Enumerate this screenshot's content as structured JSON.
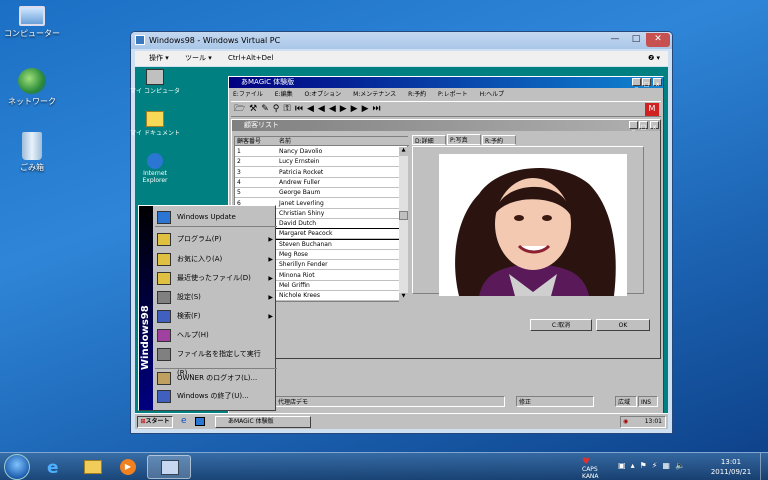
{
  "desktop": {
    "icons": [
      {
        "label": "コンピューター"
      },
      {
        "label": "ネットワーク"
      },
      {
        "label": "ごみ箱"
      }
    ]
  },
  "vpc": {
    "title": "Windows98 - Windows Virtual PC",
    "menu": {
      "ops": "操作 ▾",
      "tools": "ツール ▾",
      "cad": "Ctrl+Alt+Del"
    },
    "help": "❷ ▾"
  },
  "guest": {
    "icons": [
      {
        "label": "マイ コンピュータ"
      },
      {
        "label": "マイ ドキュメント"
      },
      {
        "label": "Internet Explorer"
      }
    ],
    "app": {
      "title": "あMAGiC 体験版",
      "menu": [
        "E:ファイル",
        "E:編集",
        "O:オプション",
        "M:メンテナンス",
        "R:予約",
        "P:レポート",
        "H:ヘルプ"
      ]
    },
    "list": {
      "title": "顧客リスト",
      "col_id": "顧客番号",
      "col_name": "名前",
      "rows": [
        {
          "id": "1",
          "name": "Nancy Davolio"
        },
        {
          "id": "2",
          "name": "Lucy Ernstein"
        },
        {
          "id": "3",
          "name": "Patricia Rocket"
        },
        {
          "id": "4",
          "name": "Andrew Fuller"
        },
        {
          "id": "5",
          "name": "George Baum"
        },
        {
          "id": "6",
          "name": "Janet Leverling"
        },
        {
          "id": "7",
          "name": "Christian Shiny"
        },
        {
          "id": "8",
          "name": "David Dutch"
        },
        {
          "id": "9",
          "name": "Margaret Peacock"
        },
        {
          "id": "10",
          "name": "Steven Buchanan"
        },
        {
          "id": "11",
          "name": "Meg Rose"
        },
        {
          "id": "12",
          "name": "Sherillyn Fender"
        },
        {
          "id": "13",
          "name": "Minona Riot"
        },
        {
          "id": "14",
          "name": "Mel Griffin"
        },
        {
          "id": "15",
          "name": "Nichole Krees"
        }
      ],
      "tabs": [
        "D:詳細",
        "P:写真",
        "R:予約"
      ],
      "cancel": "C:取消",
      "ok": "OK"
    },
    "status": {
      "dealer": "代理店デモ",
      "edit": "修正",
      "wide": "広域",
      "ins": "INS"
    },
    "start_menu": {
      "brand": "Windows98",
      "items": [
        {
          "label": "Windows Update",
          "arrow": ""
        },
        {
          "label": "プログラム(P)",
          "arrow": "▶"
        },
        {
          "label": "お気に入り(A)",
          "arrow": "▶"
        },
        {
          "label": "最近使ったファイル(D)",
          "arrow": "▶"
        },
        {
          "label": "設定(S)",
          "arrow": "▶"
        },
        {
          "label": "検索(F)",
          "arrow": "▶"
        },
        {
          "label": "ヘルプ(H)",
          "arrow": ""
        },
        {
          "label": "ファイル名を指定して実行(R)...",
          "arrow": ""
        },
        {
          "label": "OWNER のログオフ(L)...",
          "arrow": ""
        },
        {
          "label": "Windows の終了(U)...",
          "arrow": ""
        }
      ]
    },
    "taskbar": {
      "start": "スタート",
      "task": "あMAGiC 体験版",
      "clock": "13:01"
    }
  },
  "win7": {
    "tray": {
      "caps": "CAPS",
      "kana": "KANA",
      "time": "13:01",
      "date": "2011/09/21"
    }
  }
}
